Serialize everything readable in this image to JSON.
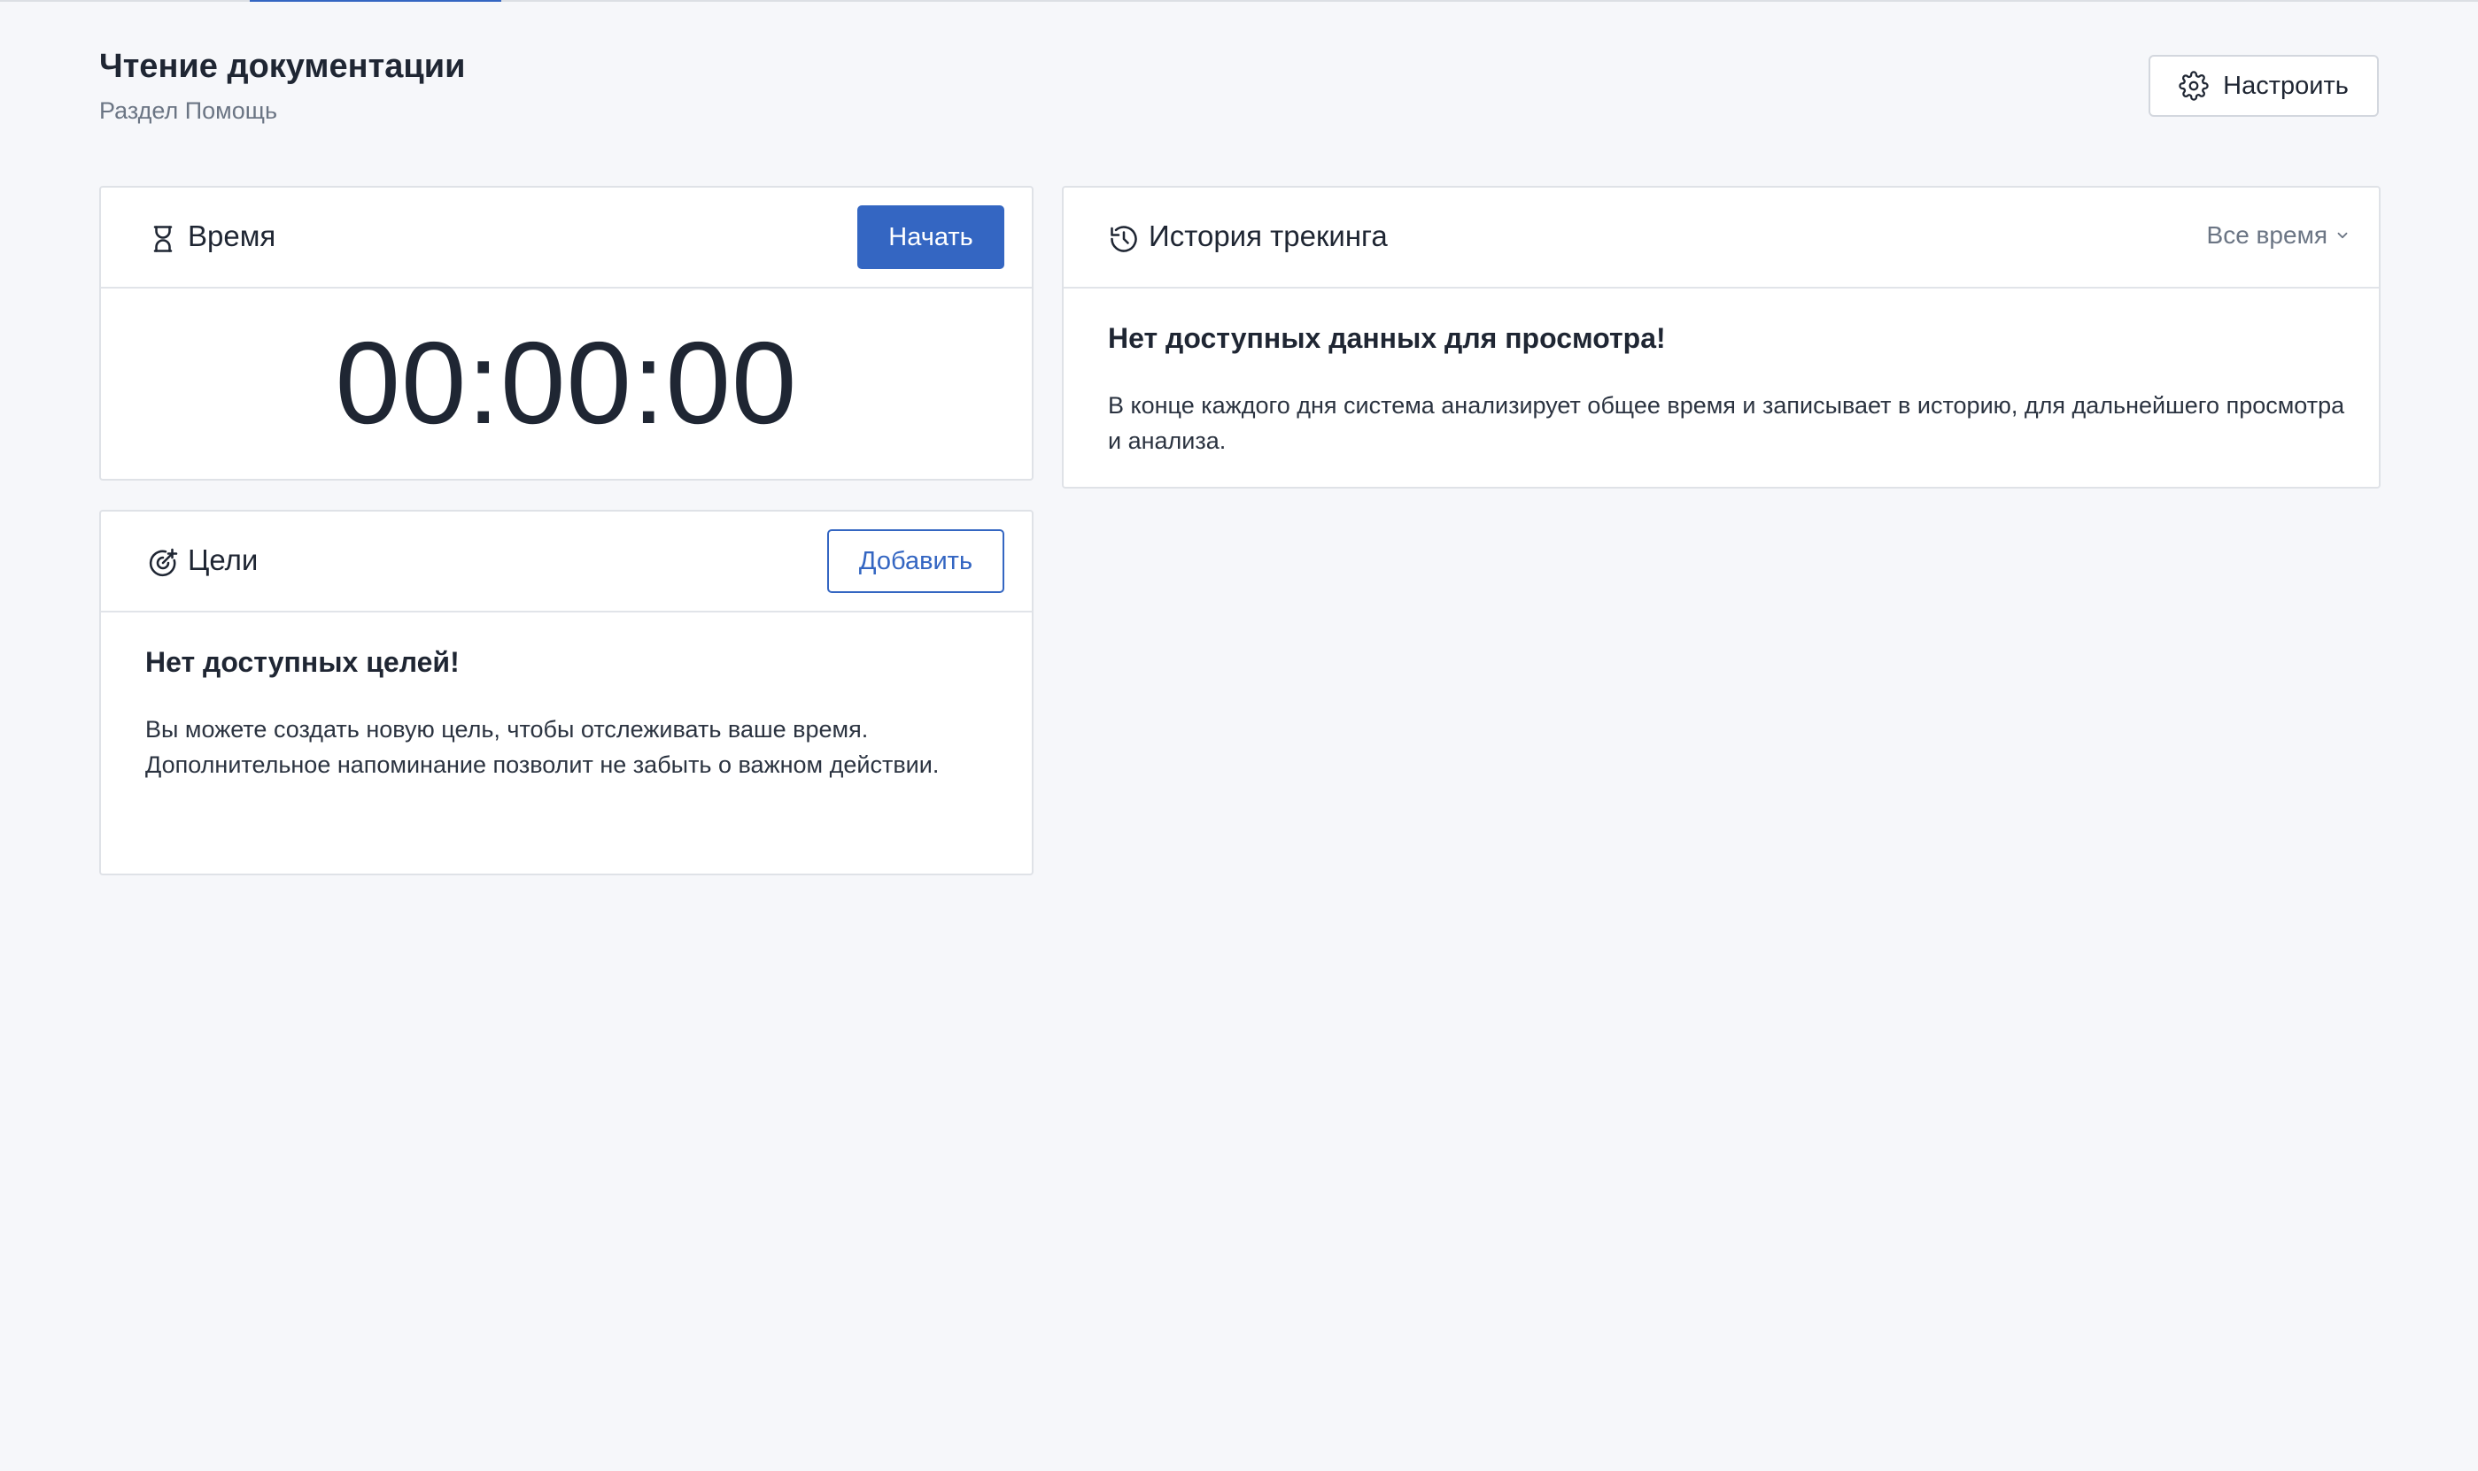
{
  "header": {
    "title": "Чтение документации",
    "subtitle": "Раздел Помощь",
    "settings_label": "Настроить"
  },
  "time_card": {
    "title": "Время",
    "start_label": "Начать",
    "timer": "00:00:00"
  },
  "goals_card": {
    "title": "Цели",
    "add_label": "Добавить",
    "empty_title": "Нет доступных целей!",
    "empty_text": "Вы можете создать новую цель, чтобы отслеживать ваше время. Дополнительное напоминание позволит не забыть о важном действии."
  },
  "history_card": {
    "title": "История трекинга",
    "filter_label": "Все время",
    "empty_title": "Нет доступных данных для просмотра!",
    "empty_text": "В конце каждого дня система анализирует общее время и записывает в историю, для дальнейшего просмотра и анализа."
  },
  "icons": {
    "settings": "gear-icon",
    "time": "hourglass-icon",
    "goals": "target-icon",
    "history": "history-icon",
    "filter": "chevron-down-icon"
  },
  "colors": {
    "accent": "#3466c2",
    "background": "#f6f7fa",
    "text": "#1f2633",
    "muted": "#6b7584"
  }
}
